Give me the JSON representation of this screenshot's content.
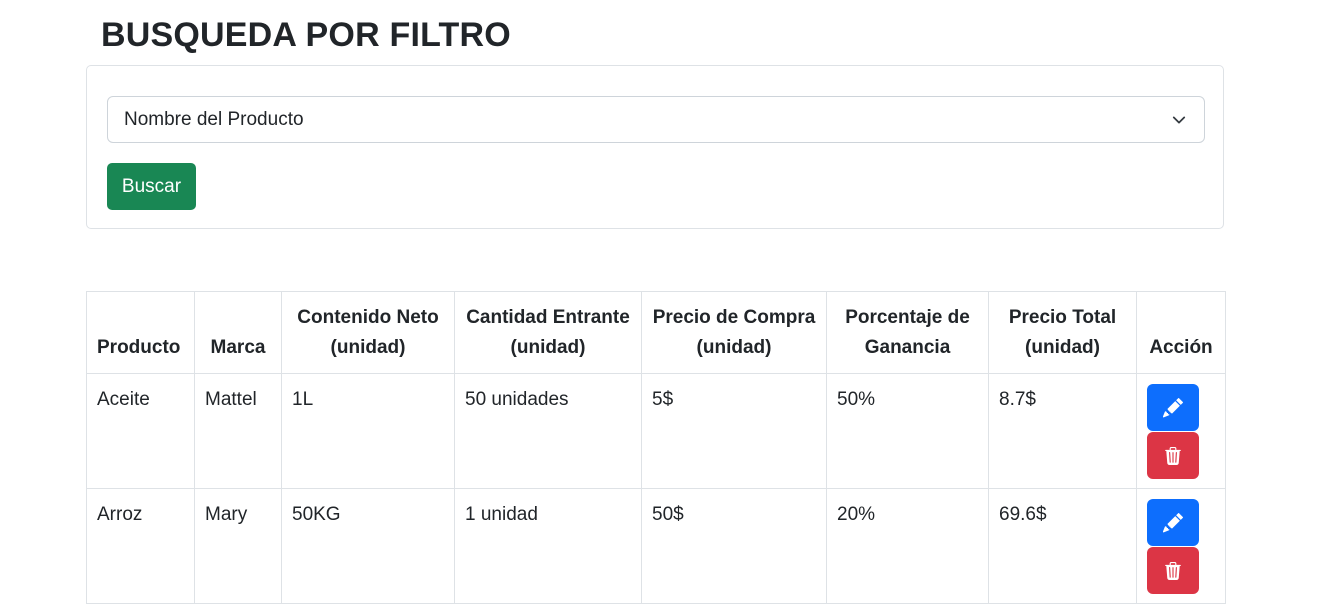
{
  "page": {
    "title": "BUSQUEDA POR FILTRO"
  },
  "filter": {
    "selected_option": "Nombre del Producto",
    "search_label": "Buscar"
  },
  "table": {
    "headers": [
      "Producto",
      "Marca",
      "Contenido Neto (unidad)",
      "Cantidad Entrante (unidad)",
      "Precio de Compra (unidad)",
      "Porcentaje de Ganancia",
      "Precio Total (unidad)",
      "Acción"
    ],
    "rows": [
      {
        "producto": "Aceite",
        "marca": "Mattel",
        "contenido": "1L",
        "cantidad": "50 unidades",
        "precio_compra": "5$",
        "porcentaje": "50%",
        "precio_total": "8.7$"
      },
      {
        "producto": "Arroz",
        "marca": "Mary",
        "contenido": "50KG",
        "cantidad": "1 unidad",
        "precio_compra": "50$",
        "porcentaje": "20%",
        "precio_total": "69.6$"
      }
    ]
  },
  "icons": {
    "edit": "pencil-icon",
    "delete": "trash-icon",
    "select": "chevron-down-icon"
  },
  "colors": {
    "primary": "#0d6efd",
    "success": "#198754",
    "danger": "#dc3545",
    "border": "#dee2e6"
  }
}
